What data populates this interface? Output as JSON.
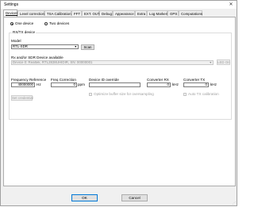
{
  "window": {
    "title": "Settings"
  },
  "tabs": [
    {
      "label": "Devices",
      "active": true
    },
    {
      "label": "Level correction",
      "active": false
    },
    {
      "label": "TSA Calibration",
      "active": false
    },
    {
      "label": "FFT",
      "active": false
    },
    {
      "label": "EXT. OUT",
      "active": false
    },
    {
      "label": "Debug",
      "active": false
    },
    {
      "label": "Appearance",
      "active": false
    },
    {
      "label": "Extra",
      "active": false
    },
    {
      "label": "Log Markers",
      "active": false
    },
    {
      "label": "GPS",
      "active": false
    },
    {
      "label": "Computations",
      "active": false
    }
  ],
  "devices": {
    "one_device": "One device",
    "two_devices": "Two devices",
    "mode_selected": "One device",
    "group_title": "RX/TX device",
    "model_label": "Model",
    "model_value": "RTL-SDR",
    "scan_label": "Scan",
    "rx_sdr_label": "Rx and/or SDR Device available",
    "rx_sdr_value": "Device 0: Realtek, RTL2838UHIDIR, SN: 00000001",
    "led_on_label": "LED On",
    "freq_ref_label": "Frequency Reference",
    "freq_ref_value": "40000000",
    "freq_ref_unit": "Hz",
    "freq_corr_label": "Freq Correction",
    "freq_corr_value": "0",
    "freq_corr_unit": "ppm",
    "device_id_label": "Device ID override",
    "device_id_value": "",
    "conv_rx_label": "Converter RX",
    "conv_rx_value": "0",
    "conv_rx_unit": "kHz",
    "conv_tx_label": "Converter TX",
    "conv_tx_value": "0",
    "conv_tx_unit": "kHz",
    "set_credential_label": "Set credential",
    "optimize_label": "Optimize buffer size for oversampling",
    "auto_tx_label": "Auto TX calibration"
  },
  "footer": {
    "ok_label": "OK",
    "cancel_label": "Cancel"
  }
}
